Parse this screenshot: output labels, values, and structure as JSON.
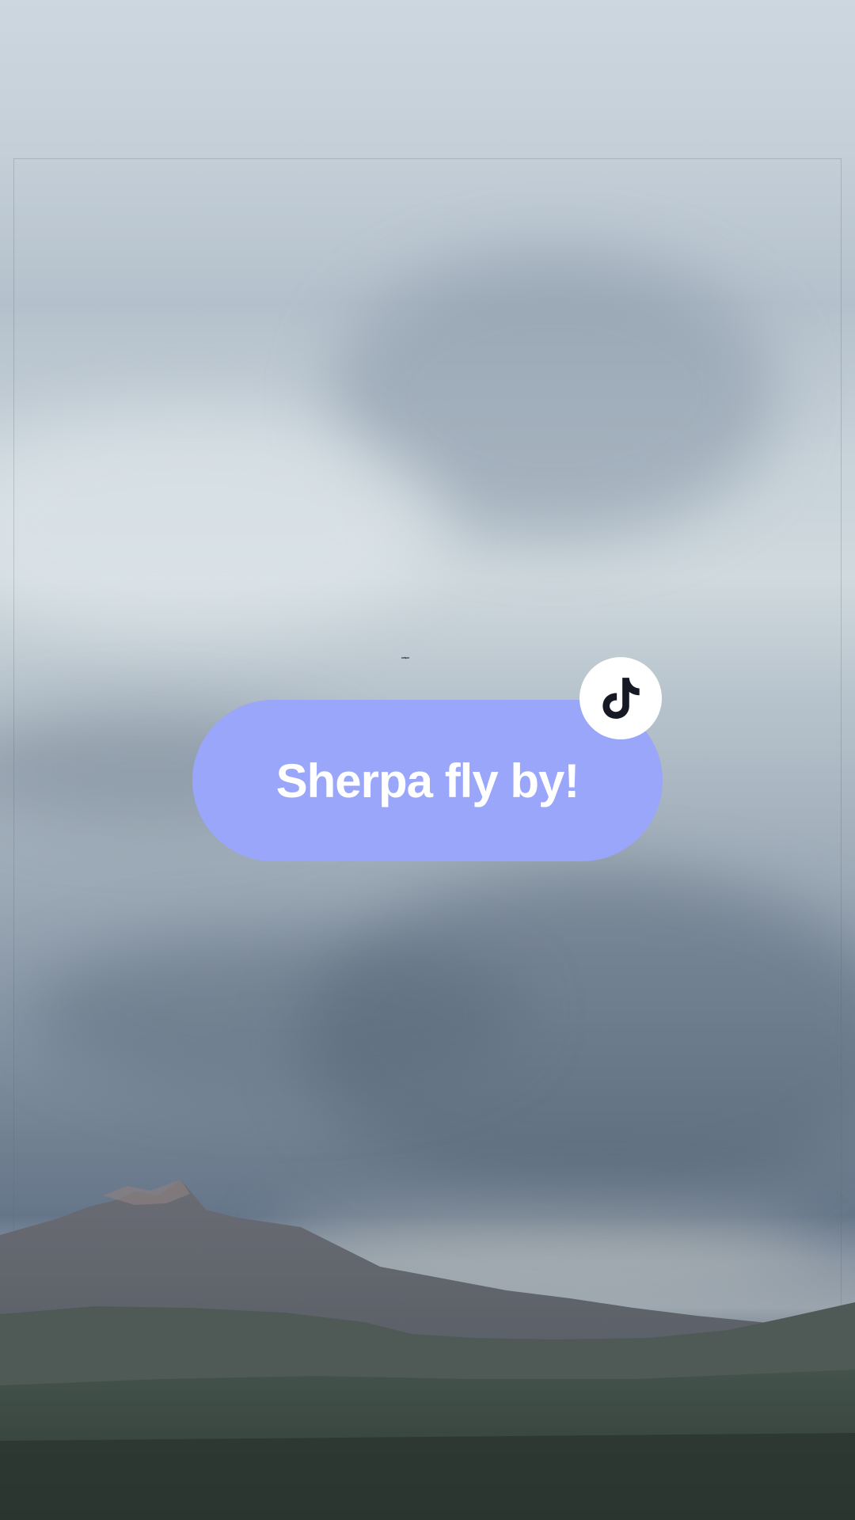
{
  "caption": {
    "text": "Sherpa fly by!",
    "pill_color": "#99a6f9",
    "text_color": "#ffffff"
  },
  "logo": {
    "icon": "tiktok-logo-icon",
    "badge_color": "#ffffff",
    "glyph_color": "#161823"
  },
  "background": {
    "scene": "cloudy-sky-over-mountain-and-forest"
  }
}
